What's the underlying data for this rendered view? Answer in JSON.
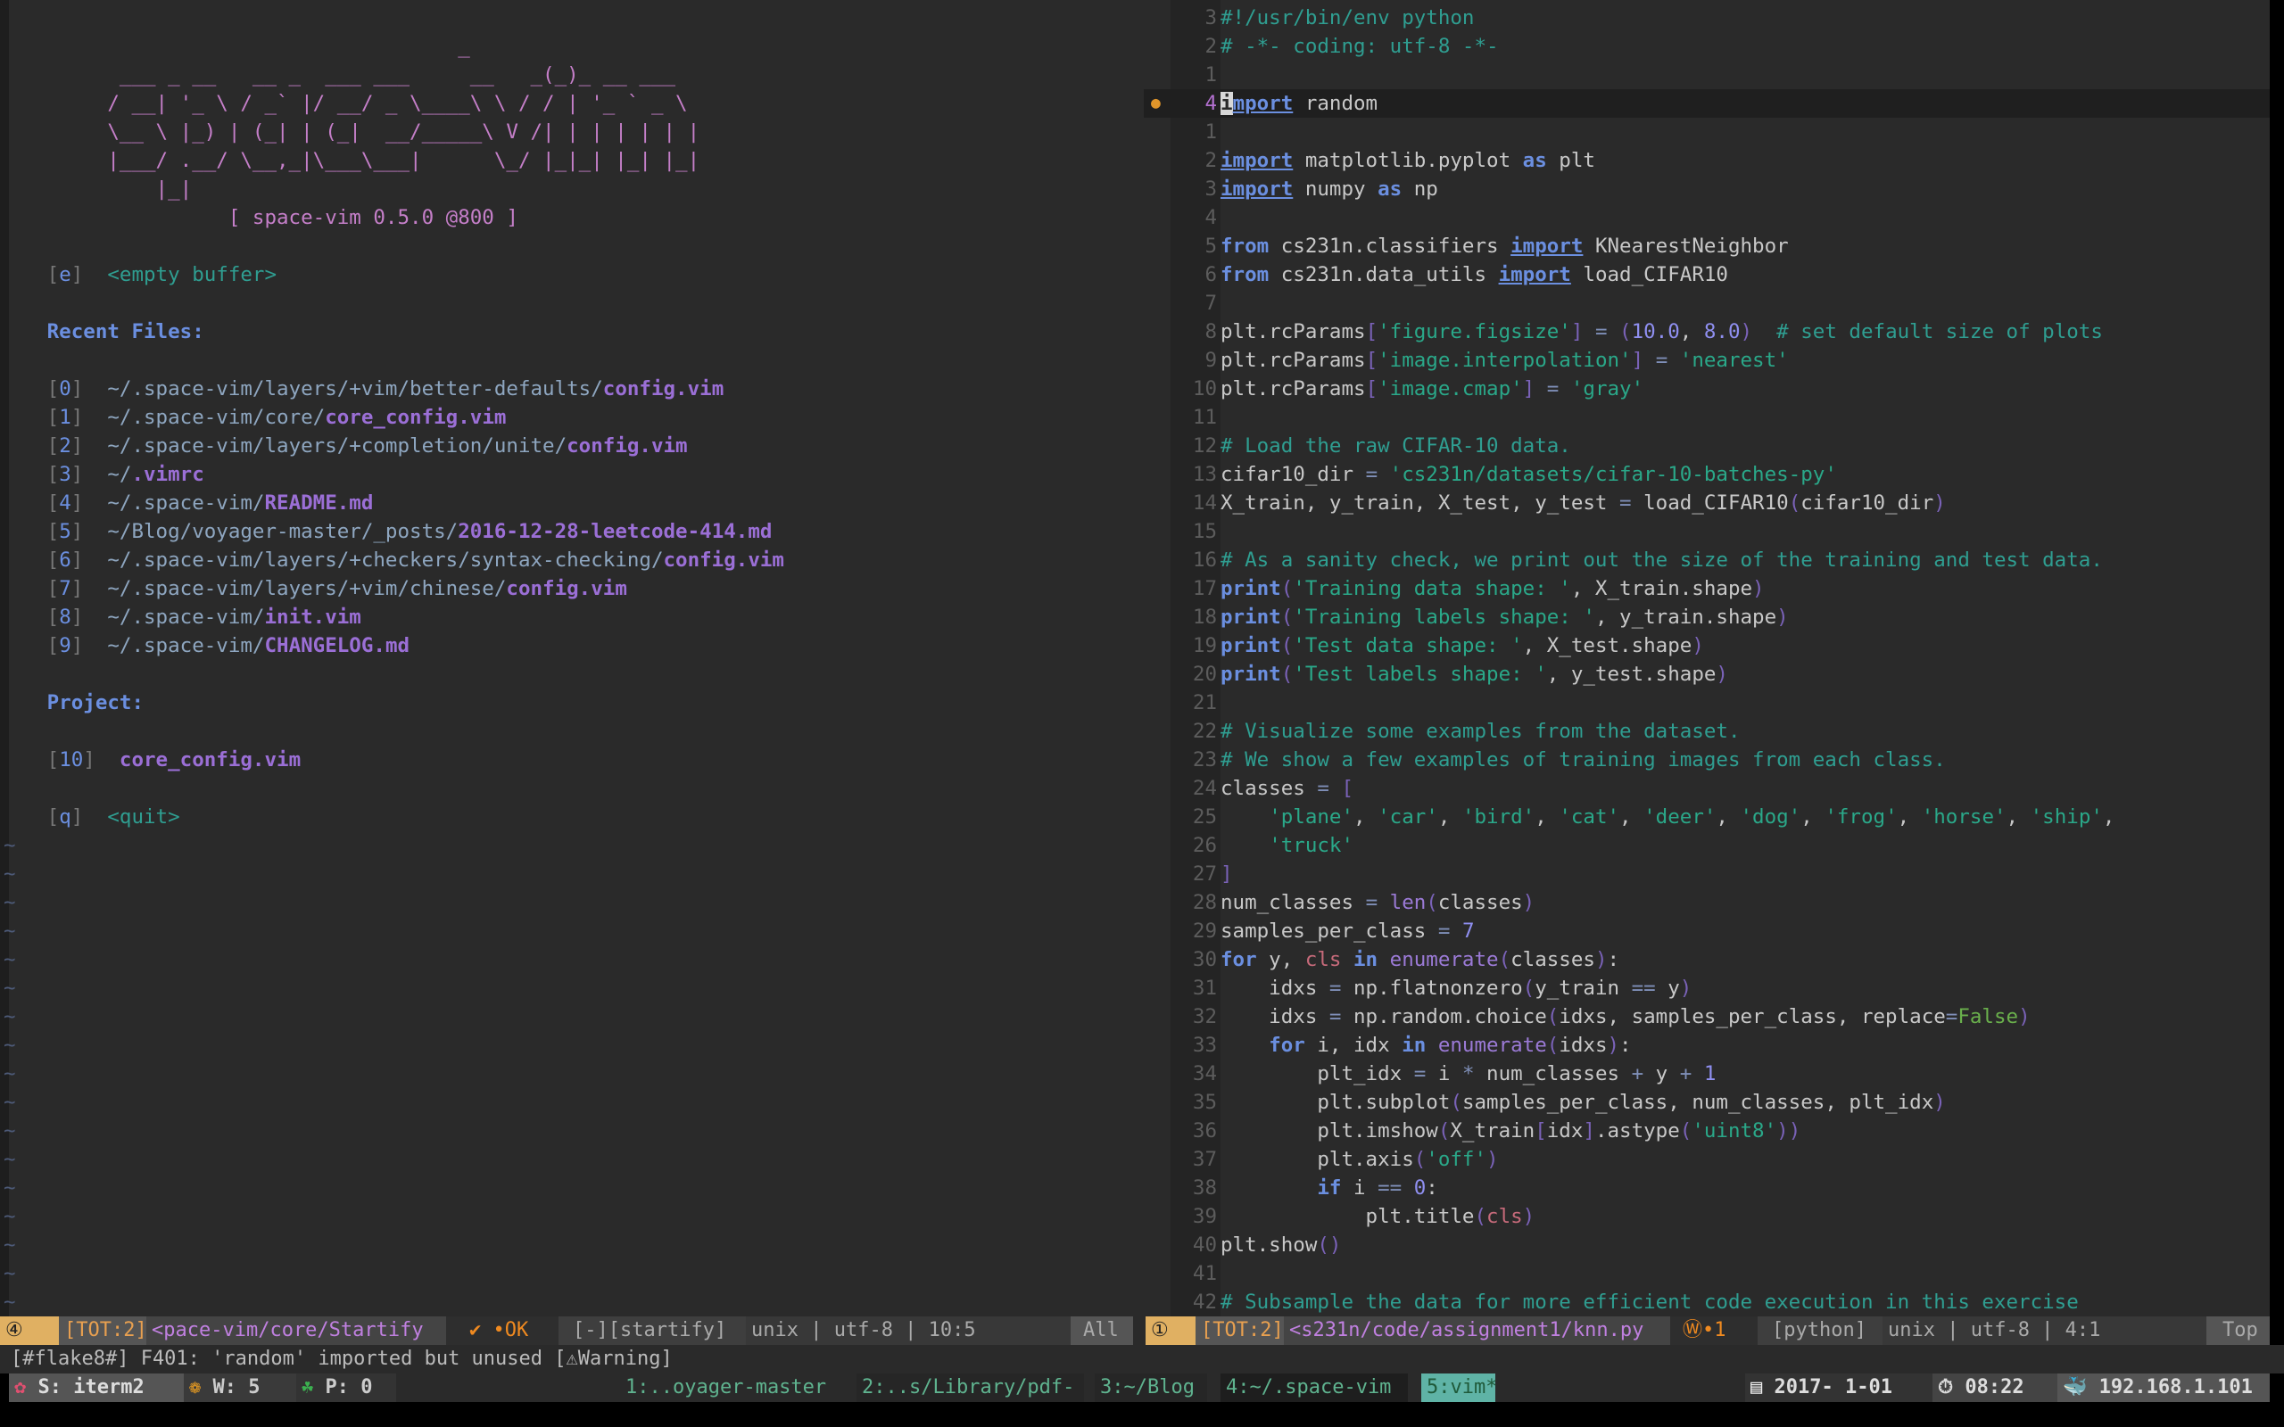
{
  "startify": {
    "banner": [
      "                                     _",
      "         ___ _ __   __ _  ___ ___     __   _(_)_ __ ___",
      "        / __| '_ \\ / _` |/ __/ _ \\____\\ \\ / / | '_ ` _ \\",
      "        \\__ \\ |_) | (_| | (_|  __/_____\\ V /| | | | | | |",
      "        |___/ .__/ \\__,_|\\___\\___|      \\_/ |_|_| |_| |_|",
      "            |_|",
      "                  [ space-vim 0.5.0 @800 ]"
    ],
    "empty_key": "e",
    "empty_label": "<empty buffer>",
    "recent_header": "Recent Files:",
    "recent_files": [
      {
        "key": "0",
        "path": "~/.space-vim/layers/+vim/better-defaults/",
        "name": "config.vim"
      },
      {
        "key": "1",
        "path": "~/.space-vim/core/",
        "name": "core_config.vim"
      },
      {
        "key": "2",
        "path": "~/.space-vim/layers/+completion/unite/",
        "name": "config.vim"
      },
      {
        "key": "3",
        "path": "~/",
        "name": ".vimrc"
      },
      {
        "key": "4",
        "path": "~/.space-vim/",
        "name": "README.md"
      },
      {
        "key": "5",
        "path": "~/Blog/voyager-master/_posts/",
        "name": "2016-12-28-leetcode-414.md"
      },
      {
        "key": "6",
        "path": "~/.space-vim/layers/+checkers/syntax-checking/",
        "name": "config.vim"
      },
      {
        "key": "7",
        "path": "~/.space-vim/layers/+vim/chinese/",
        "name": "config.vim"
      },
      {
        "key": "8",
        "path": "~/.space-vim/",
        "name": "init.vim"
      },
      {
        "key": "9",
        "path": "~/.space-vim/",
        "name": "CHANGELOG.md"
      }
    ],
    "project_header": "Project:",
    "project_files": [
      {
        "key": "10",
        "name": "core_config.vim"
      }
    ],
    "quit_key": "q",
    "quit_label": "<quit>",
    "tilde": "~"
  },
  "editor": {
    "cursor_line_sign": "●",
    "lines": [
      {
        "n": "3",
        "t": [
          [
            "c",
            "#!/usr/bin/env python"
          ]
        ]
      },
      {
        "n": "2",
        "t": [
          [
            "c",
            "# -*- coding: utf-8 -*-"
          ]
        ]
      },
      {
        "n": "1",
        "t": []
      },
      {
        "n": "4",
        "cur": true,
        "t": [
          [
            "cur",
            "i"
          ],
          [
            "ku",
            "mport"
          ],
          [
            "n",
            " random"
          ]
        ]
      },
      {
        "n": "1",
        "t": []
      },
      {
        "n": "2",
        "t": [
          [
            "ku",
            "import"
          ],
          [
            "n",
            " matplotlib.pyplot "
          ],
          [
            "k",
            "as"
          ],
          [
            "n",
            " plt"
          ]
        ]
      },
      {
        "n": "3",
        "t": [
          [
            "ku",
            "import"
          ],
          [
            "n",
            " numpy "
          ],
          [
            "k",
            "as"
          ],
          [
            "n",
            " np"
          ]
        ]
      },
      {
        "n": "4",
        "t": []
      },
      {
        "n": "5",
        "t": [
          [
            "k",
            "from"
          ],
          [
            "n",
            " cs231n.classifiers "
          ],
          [
            "ku",
            "import"
          ],
          [
            "n",
            " KNearestNeighbor"
          ]
        ]
      },
      {
        "n": "6",
        "t": [
          [
            "k",
            "from"
          ],
          [
            "n",
            " cs231n.data_utils "
          ],
          [
            "ku",
            "import"
          ],
          [
            "n",
            " load_CIFAR10"
          ]
        ]
      },
      {
        "n": "7",
        "t": []
      },
      {
        "n": "8",
        "t": [
          [
            "n",
            "plt.rcParams"
          ],
          [
            "p",
            "["
          ],
          [
            "s",
            "'figure.figsize'"
          ],
          [
            "p",
            "]"
          ],
          [
            "n",
            " "
          ],
          [
            "o",
            "="
          ],
          [
            "n",
            " "
          ],
          [
            "p",
            "("
          ],
          [
            "num",
            "10.0"
          ],
          [
            "n",
            ", "
          ],
          [
            "num",
            "8.0"
          ],
          [
            "p",
            ")"
          ],
          [
            "n",
            "  "
          ],
          [
            "c",
            "# set default size of plots"
          ]
        ]
      },
      {
        "n": "9",
        "t": [
          [
            "n",
            "plt.rcParams"
          ],
          [
            "p",
            "["
          ],
          [
            "s",
            "'image.interpolation'"
          ],
          [
            "p",
            "]"
          ],
          [
            "n",
            " "
          ],
          [
            "o",
            "="
          ],
          [
            "n",
            " "
          ],
          [
            "s",
            "'nearest'"
          ]
        ]
      },
      {
        "n": "10",
        "t": [
          [
            "n",
            "plt.rcParams"
          ],
          [
            "p",
            "["
          ],
          [
            "s",
            "'image.cmap'"
          ],
          [
            "p",
            "]"
          ],
          [
            "n",
            " "
          ],
          [
            "o",
            "="
          ],
          [
            "n",
            " "
          ],
          [
            "s",
            "'gray'"
          ]
        ]
      },
      {
        "n": "11",
        "t": []
      },
      {
        "n": "12",
        "t": [
          [
            "c",
            "# Load the raw CIFAR-10 data."
          ]
        ]
      },
      {
        "n": "13",
        "t": [
          [
            "n",
            "cifar10_dir "
          ],
          [
            "o",
            "="
          ],
          [
            "n",
            " "
          ],
          [
            "s",
            "'cs231n/datasets/cifar-10-batches-py'"
          ]
        ]
      },
      {
        "n": "14",
        "t": [
          [
            "n",
            "X_train, y_train, X_test, y_test "
          ],
          [
            "o",
            "="
          ],
          [
            "n",
            " load_CIFAR10"
          ],
          [
            "p",
            "("
          ],
          [
            "n",
            "cifar10_dir"
          ],
          [
            "p",
            ")"
          ]
        ]
      },
      {
        "n": "15",
        "t": []
      },
      {
        "n": "16",
        "t": [
          [
            "c",
            "# As a sanity check, we print out the size of the training and test data."
          ]
        ]
      },
      {
        "n": "17",
        "t": [
          [
            "k",
            "print"
          ],
          [
            "p",
            "("
          ],
          [
            "s",
            "'Training data shape: '"
          ],
          [
            "n",
            ", X_train.shape"
          ],
          [
            "p",
            ")"
          ]
        ]
      },
      {
        "n": "18",
        "t": [
          [
            "k",
            "print"
          ],
          [
            "p",
            "("
          ],
          [
            "s",
            "'Training labels shape: '"
          ],
          [
            "n",
            ", y_train.shape"
          ],
          [
            "p",
            ")"
          ]
        ]
      },
      {
        "n": "19",
        "t": [
          [
            "k",
            "print"
          ],
          [
            "p",
            "("
          ],
          [
            "s",
            "'Test data shape: '"
          ],
          [
            "n",
            ", X_test.shape"
          ],
          [
            "p",
            ")"
          ]
        ]
      },
      {
        "n": "20",
        "t": [
          [
            "k",
            "print"
          ],
          [
            "p",
            "("
          ],
          [
            "s",
            "'Test labels shape: '"
          ],
          [
            "n",
            ", y_test.shape"
          ],
          [
            "p",
            ")"
          ]
        ]
      },
      {
        "n": "21",
        "t": []
      },
      {
        "n": "22",
        "t": [
          [
            "c",
            "# Visualize some examples from the dataset."
          ]
        ]
      },
      {
        "n": "23",
        "t": [
          [
            "c",
            "# We show a few examples of training images from each class."
          ]
        ]
      },
      {
        "n": "24",
        "t": [
          [
            "n",
            "classes "
          ],
          [
            "o",
            "="
          ],
          [
            "n",
            " "
          ],
          [
            "p",
            "["
          ]
        ]
      },
      {
        "n": "25",
        "t": [
          [
            "n",
            "    "
          ],
          [
            "s",
            "'plane'"
          ],
          [
            "n",
            ", "
          ],
          [
            "s",
            "'car'"
          ],
          [
            "n",
            ", "
          ],
          [
            "s",
            "'bird'"
          ],
          [
            "n",
            ", "
          ],
          [
            "s",
            "'cat'"
          ],
          [
            "n",
            ", "
          ],
          [
            "s",
            "'deer'"
          ],
          [
            "n",
            ", "
          ],
          [
            "s",
            "'dog'"
          ],
          [
            "n",
            ", "
          ],
          [
            "s",
            "'frog'"
          ],
          [
            "n",
            ", "
          ],
          [
            "s",
            "'horse'"
          ],
          [
            "n",
            ", "
          ],
          [
            "s",
            "'ship'"
          ],
          [
            "n",
            ","
          ]
        ]
      },
      {
        "n": "26",
        "t": [
          [
            "n",
            "    "
          ],
          [
            "s",
            "'truck'"
          ]
        ]
      },
      {
        "n": "27",
        "t": [
          [
            "p",
            "]"
          ]
        ]
      },
      {
        "n": "28",
        "t": [
          [
            "n",
            "num_classes "
          ],
          [
            "o",
            "="
          ],
          [
            "n",
            " "
          ],
          [
            "f",
            "len"
          ],
          [
            "p",
            "("
          ],
          [
            "n",
            "classes"
          ],
          [
            "p",
            ")"
          ]
        ]
      },
      {
        "n": "29",
        "t": [
          [
            "n",
            "samples_per_class "
          ],
          [
            "o",
            "="
          ],
          [
            "n",
            " "
          ],
          [
            "num",
            "7"
          ]
        ]
      },
      {
        "n": "30",
        "t": [
          [
            "k",
            "for"
          ],
          [
            "n",
            " y, "
          ],
          [
            "r",
            "cls"
          ],
          [
            "n",
            " "
          ],
          [
            "k",
            "in"
          ],
          [
            "n",
            " "
          ],
          [
            "f",
            "enumerate"
          ],
          [
            "p",
            "("
          ],
          [
            "n",
            "classes"
          ],
          [
            "p",
            ")"
          ],
          [
            "n",
            ":"
          ]
        ]
      },
      {
        "n": "31",
        "t": [
          [
            "n",
            "    idxs "
          ],
          [
            "o",
            "="
          ],
          [
            "n",
            " np.flatnonzero"
          ],
          [
            "p",
            "("
          ],
          [
            "n",
            "y_train "
          ],
          [
            "o",
            "=="
          ],
          [
            "n",
            " y"
          ],
          [
            "p",
            ")"
          ]
        ]
      },
      {
        "n": "32",
        "t": [
          [
            "n",
            "    idxs "
          ],
          [
            "o",
            "="
          ],
          [
            "n",
            " np.random.choice"
          ],
          [
            "p",
            "("
          ],
          [
            "n",
            "idxs, samples_per_class, replace"
          ],
          [
            "o",
            "="
          ],
          [
            "b",
            "False"
          ],
          [
            "p",
            ")"
          ]
        ]
      },
      {
        "n": "33",
        "t": [
          [
            "n",
            "    "
          ],
          [
            "k",
            "for"
          ],
          [
            "n",
            " i, idx "
          ],
          [
            "k",
            "in"
          ],
          [
            "n",
            " "
          ],
          [
            "f",
            "enumerate"
          ],
          [
            "p",
            "("
          ],
          [
            "n",
            "idxs"
          ],
          [
            "p",
            ")"
          ],
          [
            "n",
            ":"
          ]
        ]
      },
      {
        "n": "34",
        "t": [
          [
            "n",
            "        plt_idx "
          ],
          [
            "o",
            "="
          ],
          [
            "n",
            " i "
          ],
          [
            "o",
            "*"
          ],
          [
            "n",
            " num_classes "
          ],
          [
            "o",
            "+"
          ],
          [
            "n",
            " y "
          ],
          [
            "o",
            "+"
          ],
          [
            "n",
            " "
          ],
          [
            "num",
            "1"
          ]
        ]
      },
      {
        "n": "35",
        "t": [
          [
            "n",
            "        plt.subplot"
          ],
          [
            "p",
            "("
          ],
          [
            "n",
            "samples_per_class, num_classes, plt_idx"
          ],
          [
            "p",
            ")"
          ]
        ]
      },
      {
        "n": "36",
        "t": [
          [
            "n",
            "        plt.imshow"
          ],
          [
            "p",
            "("
          ],
          [
            "n",
            "X_train"
          ],
          [
            "p",
            "["
          ],
          [
            "n",
            "idx"
          ],
          [
            "p",
            "]"
          ],
          [
            "n",
            ".astype"
          ],
          [
            "p",
            "("
          ],
          [
            "s",
            "'uint8'"
          ],
          [
            "p",
            "))"
          ]
        ]
      },
      {
        "n": "37",
        "t": [
          [
            "n",
            "        plt.axis"
          ],
          [
            "p",
            "("
          ],
          [
            "s",
            "'off'"
          ],
          [
            "p",
            ")"
          ]
        ]
      },
      {
        "n": "38",
        "t": [
          [
            "n",
            "        "
          ],
          [
            "k",
            "if"
          ],
          [
            "n",
            " i "
          ],
          [
            "o",
            "=="
          ],
          [
            "n",
            " "
          ],
          [
            "num",
            "0"
          ],
          [
            "n",
            ":"
          ]
        ]
      },
      {
        "n": "39",
        "t": [
          [
            "n",
            "            plt.title"
          ],
          [
            "p",
            "("
          ],
          [
            "r",
            "cls"
          ],
          [
            "p",
            ")"
          ]
        ]
      },
      {
        "n": "40",
        "t": [
          [
            "n",
            "plt.show"
          ],
          [
            "p",
            "()"
          ]
        ]
      },
      {
        "n": "41",
        "t": []
      },
      {
        "n": "42",
        "t": [
          [
            "c",
            "# Subsample the data for more efficient code execution in this exercise"
          ]
        ]
      }
    ]
  },
  "statusline_left": {
    "window_num": "④",
    "tot": "[TOT:2]",
    "path": "<pace-vim/core/Startify",
    "check": "✔ •OK",
    "filetype": "[-][startify]",
    "info": "unix | utf-8 | 10:5",
    "position": "All"
  },
  "statusline_right": {
    "window_num": "①",
    "tot": "[TOT:2]",
    "path": "<s231n/code/assignment1/knn.py",
    "check": "Ⓦ•1",
    "filetype": "[python]",
    "info": "unix | utf-8 | 4:1",
    "position": "Top"
  },
  "cmdline": "[#flake8#] F401: 'random' imported but unused [⚠Warning]",
  "tmux": {
    "session": "S: iterm2",
    "windows_count": "W: 5",
    "panes": "P: 0",
    "windows": [
      "1:..oyager-master",
      "2:..s/Library/pdf-",
      "3:~/Blog",
      "4:~/.space-vim",
      "5:vim*"
    ],
    "date": "2017- 1-01",
    "time": "08:22",
    "ip": "192.168.1.101"
  },
  "colors": {
    "accent": "#e0b062",
    "active_window": "#5fb3a6",
    "keyword": "#6b8fe0",
    "comment": "#2f9e91"
  }
}
